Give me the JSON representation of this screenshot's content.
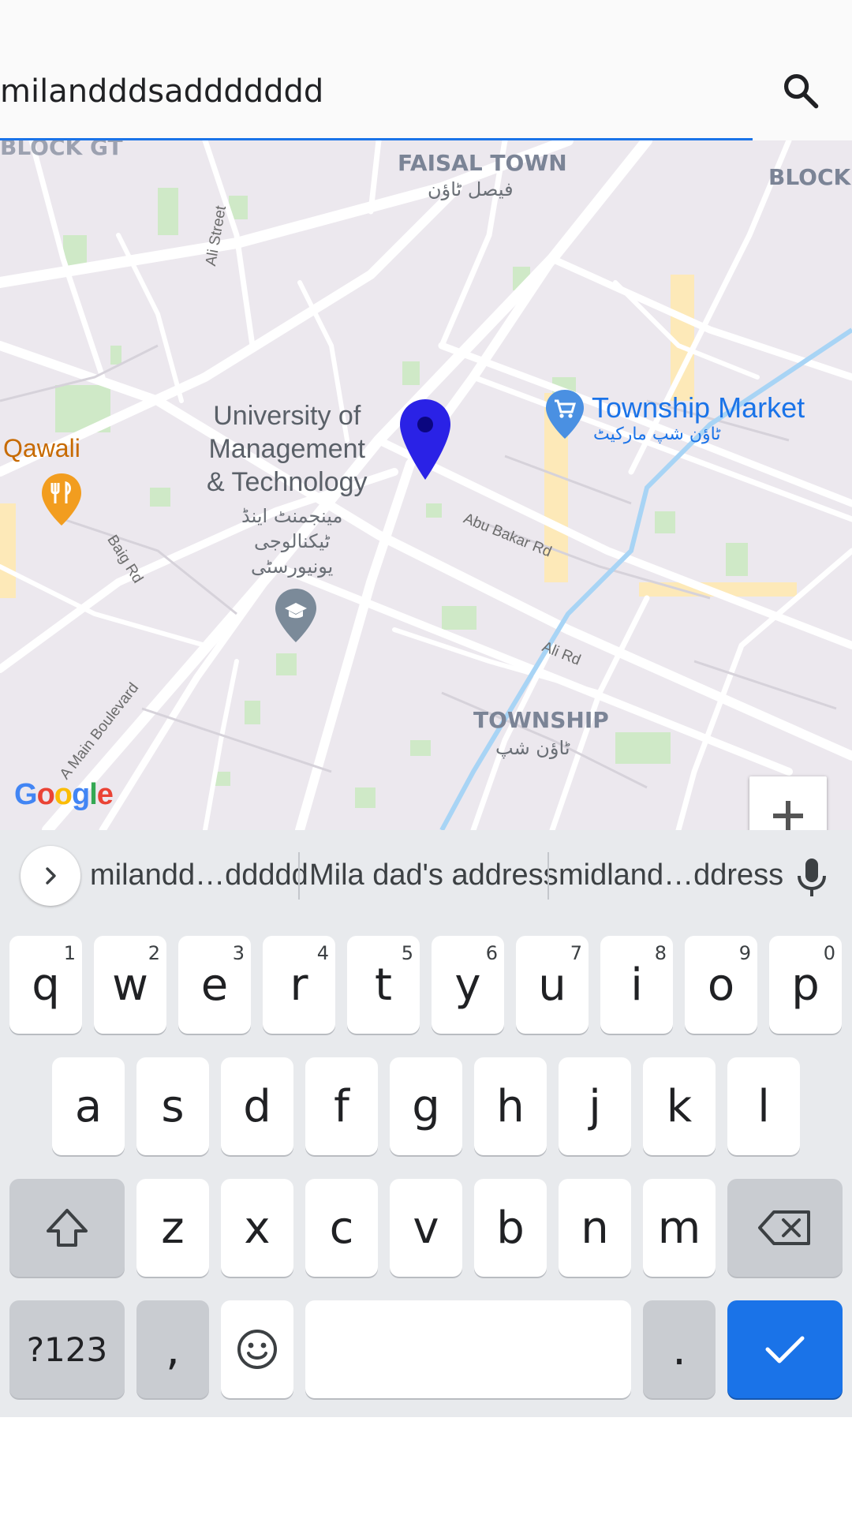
{
  "search": {
    "value": "milandddsaddddddd",
    "icon": "search-icon"
  },
  "map": {
    "area_labels": {
      "faisal_town": "FAISAL TOWN",
      "faisal_town_urdu": "فیصل ٹاؤن",
      "block_gt": "BLOCK GT",
      "block": "BLOCK",
      "township": "TOWNSHIP",
      "township_urdu": "ٹاؤن شپ"
    },
    "pois": {
      "umt_line1": "University of",
      "umt_line2": "Management",
      "umt_line3": "& Technology",
      "umt_urdu1": "مینجمنٹ اینڈ",
      "umt_urdu2": "ٹیکنالوجی",
      "umt_urdu3": "یونیورسٹی",
      "market": "Township Market",
      "market_urdu": "ٹاؤن شپ مارکیٹ",
      "qawali": "Qawali"
    },
    "roads": {
      "ali_street": "Ali Street",
      "abu_bakar_rd": "Abu Bakar Rd",
      "baig_rd": "Baig Rd",
      "ali_rd": "Ali Rd",
      "main_boulevard": "A Main Boulevard"
    },
    "zoom_in_label": "+",
    "zoom_out_label": "−",
    "attribution": {
      "letters": [
        "G",
        "o",
        "o",
        "g",
        "l",
        "e"
      ],
      "colors": [
        "#4285f4",
        "#ea4335",
        "#fbbc05",
        "#4285f4",
        "#34a853",
        "#ea4335"
      ]
    },
    "pin_color": "#2a22e6"
  },
  "keyboard": {
    "suggestions": [
      "milandd…ddddd",
      "Mila dad's address",
      "midland…ddress"
    ],
    "row1": [
      {
        "key": "q",
        "hint": "1"
      },
      {
        "key": "w",
        "hint": "2"
      },
      {
        "key": "e",
        "hint": "3"
      },
      {
        "key": "r",
        "hint": "4"
      },
      {
        "key": "t",
        "hint": "5"
      },
      {
        "key": "y",
        "hint": "6"
      },
      {
        "key": "u",
        "hint": "7"
      },
      {
        "key": "i",
        "hint": "8"
      },
      {
        "key": "o",
        "hint": "9"
      },
      {
        "key": "p",
        "hint": "0"
      }
    ],
    "row2": [
      "a",
      "s",
      "d",
      "f",
      "g",
      "h",
      "j",
      "k",
      "l"
    ],
    "row3": [
      "z",
      "x",
      "c",
      "v",
      "b",
      "n",
      "m"
    ],
    "symbols_label": "?123",
    "comma_label": ",",
    "period_label": ".",
    "accent_color": "#1a73e8"
  }
}
